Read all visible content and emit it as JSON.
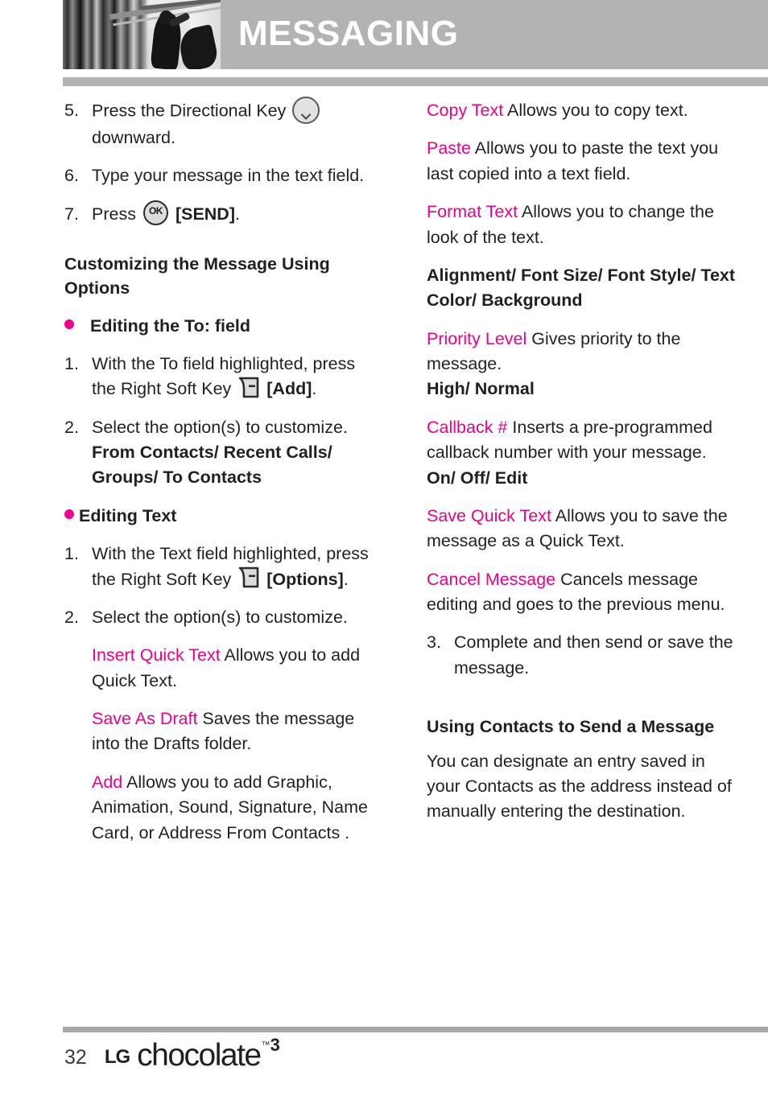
{
  "header": {
    "title": "MESSAGING",
    "photo_alt": "grayscale-photo-of-pipes-and-figure"
  },
  "icons": {
    "dpad": "directional-key-down-icon",
    "ok": "OK",
    "softkey": "right-soft-key-icon"
  },
  "left_column": {
    "steps": [
      {
        "num": "5.",
        "text_before": "Press the Directional Key",
        "icon": "dpad",
        "text_after": "downward."
      },
      {
        "num": "6.",
        "text": "Type your message in the text field."
      },
      {
        "num": "7.",
        "text_before": "Press",
        "icon": "ok",
        "bold_after": "[SEND]",
        "text_end": "."
      }
    ],
    "section_heading": "Customizing the Message Using Options",
    "bullet_to_field": "Editing the To: field",
    "to_field_steps": [
      {
        "num": "1.",
        "text_before": "With the To field highlighted, press the Right Soft Key",
        "icon": "softkey",
        "bold_after": "[Add]",
        "text_end": "."
      },
      {
        "num": "2.",
        "text": "Select the option(s) to customize.",
        "bold_values": "From Contacts/ Recent Calls/ Groups/ To Contacts"
      }
    ],
    "bullet_editing_text": "Editing Text",
    "editing_text_steps": [
      {
        "num": "1.",
        "text_before": "With the Text field highlighted, press the Right Soft Key",
        "icon": "softkey",
        "bold_after": "[Options]",
        "text_end": "."
      },
      {
        "num": "2.",
        "text": "Select the option(s) to customize."
      }
    ],
    "options": [
      {
        "term": "Insert Quick Text",
        "desc": " Allows you to add Quick Text."
      },
      {
        "term": "Save As Draft",
        "desc": " Saves the message into the Drafts folder."
      },
      {
        "term": "Add",
        "desc": "  Allows you to add Graphic, Animation, Sound, Signature, Name Card, or Address From Contacts ."
      }
    ]
  },
  "right_column": {
    "options": [
      {
        "term": "Copy Text",
        "desc": "  Allows you to copy text."
      },
      {
        "term": "Paste",
        "desc": "  Allows you to paste the text you last copied into a text field."
      },
      {
        "term": "Format Text",
        "desc": "  Allows you to change the look of the text.",
        "values": "Alignment/ Font Size/ Font Style/ Text Color/ Background"
      },
      {
        "term": "Priority Level",
        "desc": "  Gives priority to the message.",
        "values": "High/ Normal"
      },
      {
        "term": "Callback #",
        "desc": " Inserts a pre-programmed callback number with your message.",
        "values": "On/ Off/ Edit"
      },
      {
        "term": "Save Quick Text",
        "desc": "  Allows you to save the message as a Quick Text."
      },
      {
        "term": "Cancel Message",
        "desc": "  Cancels message editing and goes to the previous menu."
      }
    ],
    "final_step": {
      "num": "3.",
      "text": "Complete and then send or save the message."
    },
    "contacts_heading": "Using Contacts to Send a Message",
    "contacts_body": "You can designate an entry saved in your Contacts as the address instead of manually entering the destination."
  },
  "footer": {
    "page_number": "32",
    "logo_lg": "LG",
    "logo_word": "chocolate",
    "logo_tm": "™",
    "logo_version": "3"
  },
  "colors": {
    "accent_magenta": "#ec008c",
    "header_gray": "#b3b3b3",
    "text_dark": "#231f20",
    "rule_gray": "#a7a7a7"
  }
}
